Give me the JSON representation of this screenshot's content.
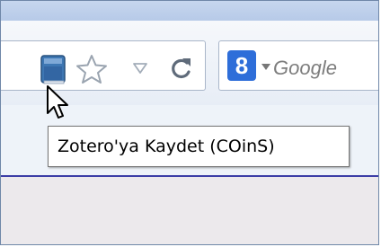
{
  "tooltip": {
    "text": "Zotero'ya Kaydet (COinS)"
  },
  "search": {
    "engine_letter": "8",
    "placeholder": "Google"
  },
  "icons": {
    "zotero": "book-icon",
    "bookmark": "star-icon",
    "dropdown": "triangle-down-icon",
    "reload": "reload-icon",
    "search_engine": "google-icon",
    "pointer": "mouse-cursor-icon"
  },
  "colors": {
    "accent": "#2e6ed9",
    "book": "#3e77b3",
    "divider": "#3c3ea6"
  }
}
